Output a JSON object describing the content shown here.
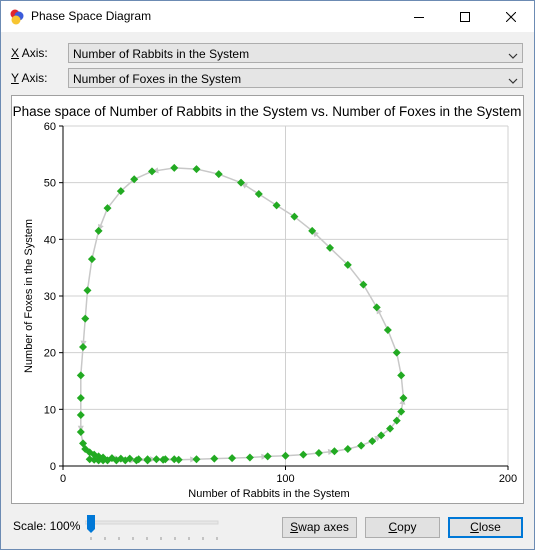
{
  "window": {
    "title": "Phase Space Diagram"
  },
  "icons": {
    "app": "phase-diagram-app-icon",
    "minimize": "minimize-icon",
    "maximize": "maximize-icon",
    "close": "close-icon",
    "dropdown": "chevron-down-icon"
  },
  "x_axis_selector": {
    "label_key": "X",
    "label_rest": " Axis:",
    "selected": "Number of Rabbits in the System"
  },
  "y_axis_selector": {
    "label_key": "Y",
    "label_rest": " Axis:",
    "selected": "Number of Foxes in the System"
  },
  "scale": {
    "label": "Scale: 100%",
    "value_percent": 100,
    "slider_fraction": 0.0
  },
  "buttons": {
    "swap": {
      "key": "S",
      "rest": "wap axes"
    },
    "copy": {
      "key": "C",
      "rest": "opy"
    },
    "close": {
      "key": "C",
      "rest": "lose"
    }
  },
  "colors": {
    "series": "#22aa22",
    "arrows": "#c8c8c8",
    "grid": "#d0d0d0",
    "focus": "#0078d7"
  },
  "chart_data": {
    "type": "scatter",
    "title": "Phase space of Number of Rabbits in the System vs. Number of Foxes in the System",
    "xlabel": "Number of Rabbits in the System",
    "ylabel": "Number of Foxes in the System",
    "xlim": [
      0,
      200
    ],
    "ylim": [
      0,
      60
    ],
    "xticks": [
      0,
      100,
      200
    ],
    "yticks": [
      0,
      10,
      20,
      30,
      40,
      50,
      60
    ],
    "grid": true,
    "series": [
      {
        "x": [
          12,
          14,
          16,
          18,
          20,
          24,
          28,
          33,
          38,
          45,
          52,
          60,
          68,
          76,
          84,
          92,
          100,
          108,
          115,
          122,
          128,
          134,
          139,
          143,
          147,
          150,
          152,
          153,
          152,
          150,
          146,
          141,
          135,
          128,
          120,
          112,
          104,
          96,
          88,
          80,
          70,
          60,
          50,
          40,
          32,
          26,
          20,
          16,
          13,
          11,
          10,
          9,
          8,
          8,
          8,
          8,
          9,
          10,
          12,
          14,
          16,
          18,
          22,
          26,
          30,
          34,
          38,
          42,
          46,
          50
        ],
        "y": [
          1.2,
          1.1,
          1.0,
          1.0,
          1.0,
          1.0,
          1.0,
          1.0,
          1.0,
          1.1,
          1.1,
          1.2,
          1.3,
          1.4,
          1.5,
          1.7,
          1.8,
          2.0,
          2.3,
          2.6,
          3.0,
          3.6,
          4.4,
          5.4,
          6.6,
          8.0,
          9.6,
          12.0,
          16,
          20,
          24,
          28,
          32,
          35.5,
          38.5,
          41.5,
          44,
          46,
          48,
          50,
          51.5,
          52.4,
          52.6,
          52.0,
          50.6,
          48.5,
          45.5,
          41.5,
          36.5,
          31,
          26,
          21,
          16,
          12,
          9,
          6,
          4,
          3,
          2.4,
          2.0,
          1.7,
          1.5,
          1.4,
          1.3,
          1.3,
          1.2,
          1.2,
          1.2,
          1.2,
          1.2
        ]
      }
    ]
  }
}
